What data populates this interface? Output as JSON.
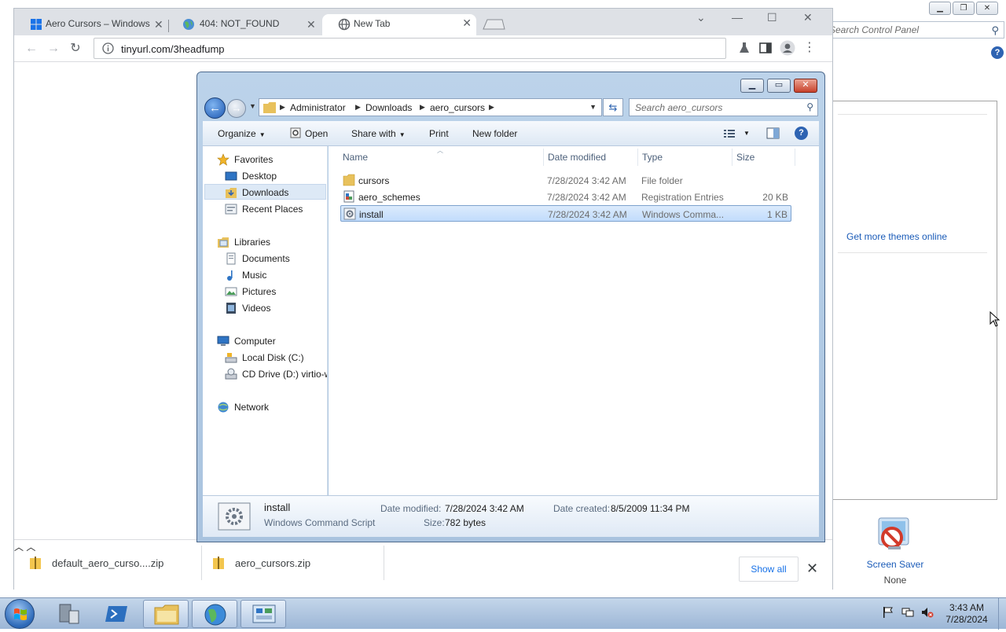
{
  "control_panel": {
    "search_placeholder": "Search Control Panel",
    "link_get_themes": "Get more themes online",
    "screen_saver_label": "Screen Saver",
    "screen_saver_value": "None"
  },
  "chrome": {
    "tabs": [
      {
        "label": "Aero Cursors – Windows"
      },
      {
        "label": "404: NOT_FOUND"
      },
      {
        "label": "New Tab"
      }
    ],
    "url": "tinyurl.com/3headfump",
    "downloads": [
      {
        "name": "default_aero_curso....zip"
      },
      {
        "name": "aero_cursors.zip"
      }
    ],
    "show_all": "Show all"
  },
  "explorer": {
    "breadcrumbs": [
      "Administrator",
      "Downloads",
      "aero_cursors"
    ],
    "search_placeholder": "Search aero_cursors",
    "commands": {
      "organize": "Organize",
      "open": "Open",
      "share_with": "Share with",
      "print": "Print",
      "new_folder": "New folder"
    },
    "nav": {
      "favorites": "Favorites",
      "desktop": "Desktop",
      "downloads": "Downloads",
      "recent_places": "Recent Places",
      "libraries": "Libraries",
      "documents": "Documents",
      "music": "Music",
      "pictures": "Pictures",
      "videos": "Videos",
      "computer": "Computer",
      "local_disk": "Local Disk (C:)",
      "cd_drive": "CD Drive (D:) virtio-w",
      "network": "Network"
    },
    "columns": {
      "name": "Name",
      "date": "Date modified",
      "type": "Type",
      "size": "Size"
    },
    "files": [
      {
        "name": "cursors",
        "date": "7/28/2024 3:42 AM",
        "type": "File folder",
        "size": ""
      },
      {
        "name": "aero_schemes",
        "date": "7/28/2024 3:42 AM",
        "type": "Registration Entries",
        "size": "20 KB"
      },
      {
        "name": "install",
        "date": "7/28/2024 3:42 AM",
        "type": "Windows Comma...",
        "size": "1 KB"
      }
    ],
    "details": {
      "name": "install",
      "kind": "Windows Command Script",
      "date_modified_label": "Date modified:",
      "date_modified": "7/28/2024 3:42 AM",
      "date_created_label": "Date created:",
      "date_created": "8/5/2009 11:34 PM",
      "size_label": "Size:",
      "size": "782 bytes"
    }
  },
  "taskbar": {
    "time": "3:43 AM",
    "date": "7/28/2024"
  },
  "colors": {
    "accent_link": "#1a5bb8",
    "selection": "#c1dcfc",
    "taskbar": "#9cb6d6"
  }
}
